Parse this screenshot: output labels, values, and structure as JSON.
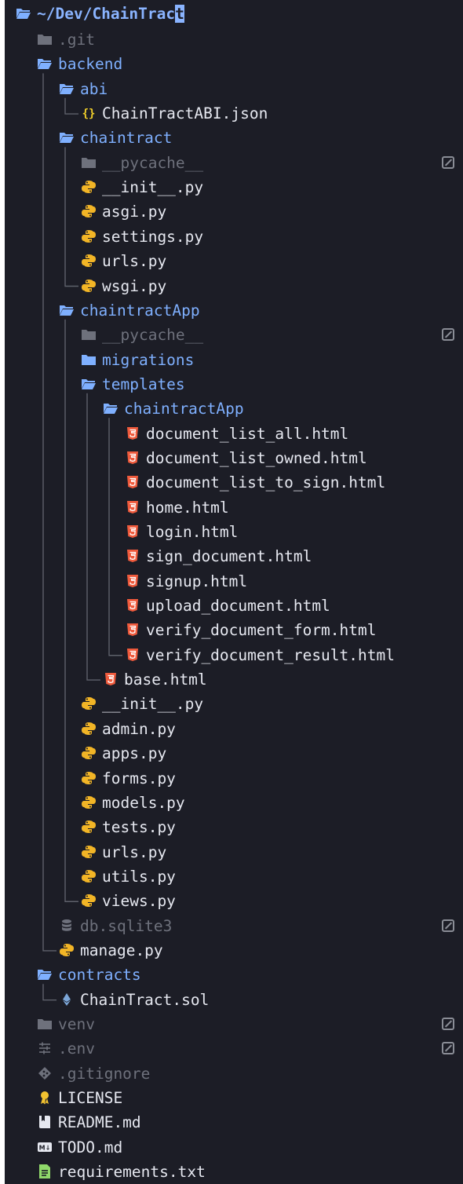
{
  "root": {
    "path_text": "~/Dev/ChainTrac",
    "cursor_char": "t"
  },
  "colors": {
    "background": "#1c1d26",
    "folder": "#7fb0ff",
    "text": "#e6e8f0",
    "dim_text": "#6e717c",
    "python_icon": "#f2b526",
    "html_icon": "#ef5a3c",
    "json_icon": "#f2d02a",
    "ethereum_icon": "#7ca6d8",
    "license_icon": "#f2c230",
    "text_file_icon": "#8fd86a",
    "modified_badge": "#8a8d96"
  },
  "tree": [
    {
      "name": ".git",
      "kind": "folder-closed",
      "depth": 1,
      "dim": true
    },
    {
      "name": "backend",
      "kind": "folder-open",
      "depth": 1
    },
    {
      "name": "abi",
      "kind": "folder-open",
      "depth": 2
    },
    {
      "name": "ChainTractABI.json",
      "kind": "json",
      "depth": 3,
      "elbow": true
    },
    {
      "name": "chaintract",
      "kind": "folder-open",
      "depth": 2
    },
    {
      "name": "__pycache__",
      "kind": "folder-closed",
      "depth": 3,
      "dim": true,
      "modified": true
    },
    {
      "name": "__init__.py",
      "kind": "python",
      "depth": 3
    },
    {
      "name": "asgi.py",
      "kind": "python",
      "depth": 3
    },
    {
      "name": "settings.py",
      "kind": "python",
      "depth": 3
    },
    {
      "name": "urls.py",
      "kind": "python",
      "depth": 3
    },
    {
      "name": "wsgi.py",
      "kind": "python",
      "depth": 3,
      "elbow": true
    },
    {
      "name": "chaintractApp",
      "kind": "folder-open",
      "depth": 2
    },
    {
      "name": "__pycache__",
      "kind": "folder-closed",
      "depth": 3,
      "dim": true,
      "modified": true
    },
    {
      "name": "migrations",
      "kind": "folder-closed",
      "depth": 3,
      "folder_label": true
    },
    {
      "name": "templates",
      "kind": "folder-open",
      "depth": 3
    },
    {
      "name": "chaintractApp",
      "kind": "folder-open",
      "depth": 4
    },
    {
      "name": "document_list_all.html",
      "kind": "html",
      "depth": 5
    },
    {
      "name": "document_list_owned.html",
      "kind": "html",
      "depth": 5
    },
    {
      "name": "document_list_to_sign.html",
      "kind": "html",
      "depth": 5
    },
    {
      "name": "home.html",
      "kind": "html",
      "depth": 5
    },
    {
      "name": "login.html",
      "kind": "html",
      "depth": 5
    },
    {
      "name": "sign_document.html",
      "kind": "html",
      "depth": 5
    },
    {
      "name": "signup.html",
      "kind": "html",
      "depth": 5
    },
    {
      "name": "upload_document.html",
      "kind": "html",
      "depth": 5
    },
    {
      "name": "verify_document_form.html",
      "kind": "html",
      "depth": 5
    },
    {
      "name": "verify_document_result.html",
      "kind": "html",
      "depth": 5,
      "elbow": true
    },
    {
      "name": "base.html",
      "kind": "html",
      "depth": 4,
      "elbow": true
    },
    {
      "name": "__init__.py",
      "kind": "python",
      "depth": 3
    },
    {
      "name": "admin.py",
      "kind": "python",
      "depth": 3
    },
    {
      "name": "apps.py",
      "kind": "python",
      "depth": 3
    },
    {
      "name": "forms.py",
      "kind": "python",
      "depth": 3
    },
    {
      "name": "models.py",
      "kind": "python",
      "depth": 3
    },
    {
      "name": "tests.py",
      "kind": "python",
      "depth": 3
    },
    {
      "name": "urls.py",
      "kind": "python",
      "depth": 3
    },
    {
      "name": "utils.py",
      "kind": "python",
      "depth": 3
    },
    {
      "name": "views.py",
      "kind": "python",
      "depth": 3,
      "elbow": true
    },
    {
      "name": "db.sqlite3",
      "kind": "database",
      "depth": 2,
      "dim": true,
      "modified": true
    },
    {
      "name": "manage.py",
      "kind": "python",
      "depth": 2,
      "elbow": true
    },
    {
      "name": "contracts",
      "kind": "folder-open",
      "depth": 1
    },
    {
      "name": "ChainTract.sol",
      "kind": "ethereum",
      "depth": 2,
      "elbow": true
    },
    {
      "name": "venv",
      "kind": "folder-closed",
      "depth": 1,
      "dim": true,
      "modified": true
    },
    {
      "name": ".env",
      "kind": "settings",
      "depth": 1,
      "dim": true,
      "modified": true
    },
    {
      "name": ".gitignore",
      "kind": "git",
      "depth": 1,
      "dim": true
    },
    {
      "name": "LICENSE",
      "kind": "license",
      "depth": 1
    },
    {
      "name": "README.md",
      "kind": "book",
      "depth": 1
    },
    {
      "name": "TODO.md",
      "kind": "markdown",
      "depth": 1
    },
    {
      "name": "requirements.txt",
      "kind": "text",
      "depth": 1
    }
  ]
}
